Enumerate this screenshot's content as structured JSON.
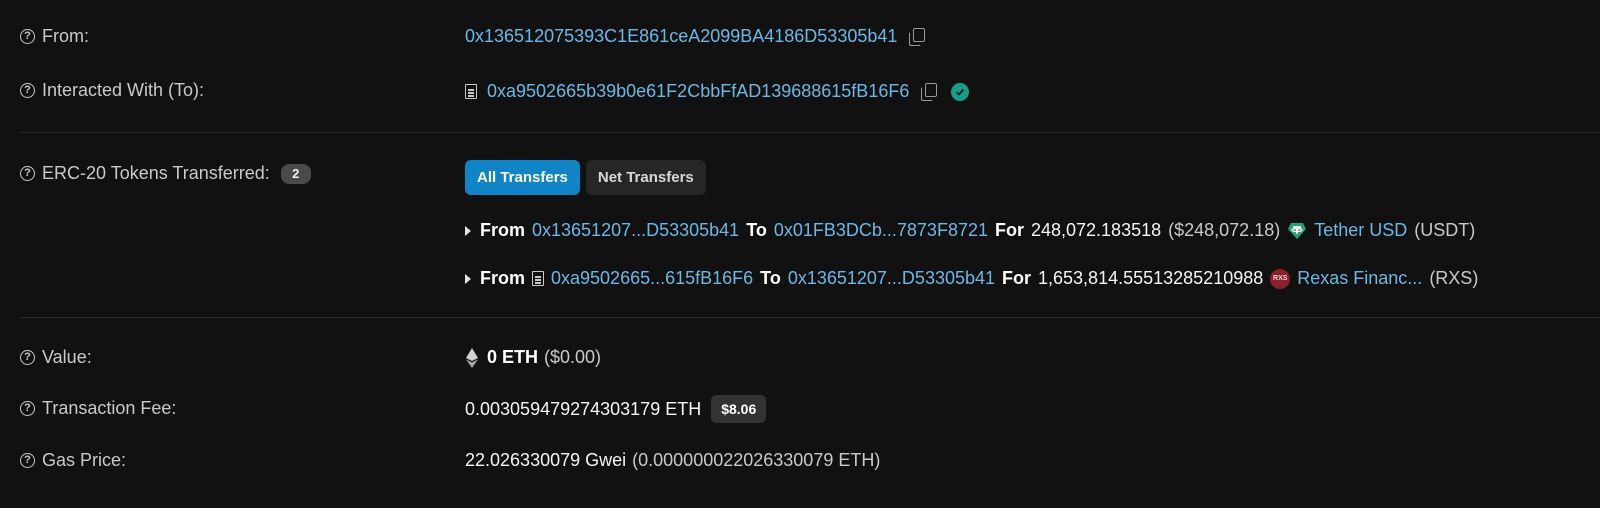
{
  "from": {
    "label": "From:",
    "address": "0x136512075393C1E861ceA2099BA4186D53305b41"
  },
  "interacted_with": {
    "label": "Interacted With (To):",
    "address": "0xa9502665b39b0e61F2CbbFfAD139688615fB16F6"
  },
  "erc20": {
    "label": "ERC-20 Tokens Transferred:",
    "count": "2",
    "tabs": [
      "All Transfers",
      "Net Transfers"
    ],
    "transfers": [
      {
        "from_word": "From",
        "from": "0x13651207...D53305b41",
        "to_word": "To",
        "to": "0x01FB3DCb...7873F8721",
        "for_word": "For",
        "amount": "248,072.183518",
        "usd": "($248,072.18)",
        "token_icon": "tether-icon",
        "token_name": "Tether USD",
        "token_symbol": "(USDT)"
      },
      {
        "from_word": "From",
        "from": "0xa9502665...615fB16F6",
        "to_word": "To",
        "to": "0x13651207...D53305b41",
        "for_word": "For",
        "amount": "1,653,814.55513285210988",
        "token_icon": "rexas-icon",
        "token_icon_text": "RXS",
        "token_name": "Rexas Financ...",
        "token_symbol": "(RXS)"
      }
    ]
  },
  "value": {
    "label": "Value:",
    "amount": "0 ETH",
    "usd": "($0.00)"
  },
  "fee": {
    "label": "Transaction Fee:",
    "amount": "0.003059479274303179 ETH",
    "usd_badge": "$8.06"
  },
  "gas": {
    "label": "Gas Price:",
    "amount": "22.026330079 Gwei",
    "eth": "(0.000000022026330079 ETH)"
  },
  "colors": {
    "background": "#111111",
    "link": "#6ab8e6",
    "primary_button": "#0f84c6",
    "verified": "#12a087"
  }
}
